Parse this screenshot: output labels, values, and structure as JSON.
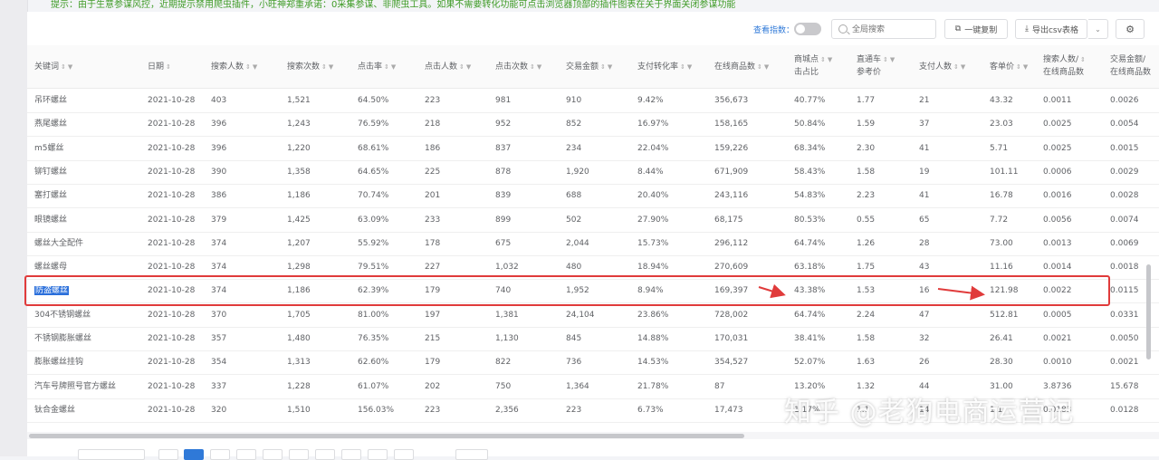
{
  "notice": "提示：由于生意参谋风控，近期提示禁用爬虫插件，小旺神郑重承诺：0采集参谋、非爬虫工具。如果不需要转化功能可点击浏览器顶部的插件图表在关于界面关闭参谋功能",
  "toolbar": {
    "index_toggle_label": "查看指数：",
    "search_placeholder": "全局搜索",
    "copy_label": "一键复制",
    "export_label": "导出csv表格"
  },
  "columns": [
    {
      "label": "关键词",
      "sort": true,
      "filter": true
    },
    {
      "label": "日期",
      "sort": true,
      "filter": false
    },
    {
      "label": "搜索人数",
      "sort": true,
      "filter": true
    },
    {
      "label": "搜索次数",
      "sort": true,
      "filter": true
    },
    {
      "label": "点击率",
      "sort": true,
      "filter": true
    },
    {
      "label": "点击人数",
      "sort": true,
      "filter": true
    },
    {
      "label": "点击次数",
      "sort": true,
      "filter": true
    },
    {
      "label": "交易金额",
      "sort": true,
      "filter": true
    },
    {
      "label": "支付转化率",
      "sort": true,
      "filter": true
    },
    {
      "label": "在线商品数",
      "sort": true,
      "filter": true
    },
    {
      "label": "商城点\n击占比",
      "sort": true,
      "filter": true
    },
    {
      "label": "直通车\n参考价",
      "sort": true,
      "filter": true
    },
    {
      "label": "支付人数",
      "sort": true,
      "filter": true
    },
    {
      "label": "客单价",
      "sort": true,
      "filter": true
    },
    {
      "label": "搜索人数/\n在线商品数",
      "sort": true,
      "filter": false
    },
    {
      "label": "交易金额/\n在线商品数",
      "sort": false,
      "filter": false
    }
  ],
  "rows": [
    [
      "吊环螺丝",
      "2021-10-28",
      "403",
      "1,521",
      "64.50%",
      "223",
      "981",
      "910",
      "9.42%",
      "356,673",
      "40.77%",
      "1.77",
      "21",
      "43.32",
      "0.0011",
      "0.0026"
    ],
    [
      "燕尾螺丝",
      "2021-10-28",
      "396",
      "1,243",
      "76.59%",
      "218",
      "952",
      "852",
      "16.97%",
      "158,165",
      "50.84%",
      "1.59",
      "37",
      "23.03",
      "0.0025",
      "0.0054"
    ],
    [
      "m5螺丝",
      "2021-10-28",
      "396",
      "1,220",
      "68.61%",
      "186",
      "837",
      "234",
      "22.04%",
      "159,226",
      "68.34%",
      "2.30",
      "41",
      "5.71",
      "0.0025",
      "0.0015"
    ],
    [
      "铆钉螺丝",
      "2021-10-28",
      "390",
      "1,358",
      "64.65%",
      "225",
      "878",
      "1,920",
      "8.44%",
      "671,909",
      "58.43%",
      "1.58",
      "19",
      "101.11",
      "0.0006",
      "0.0029"
    ],
    [
      "塞打螺丝",
      "2021-10-28",
      "386",
      "1,186",
      "70.74%",
      "201",
      "839",
      "688",
      "20.40%",
      "243,116",
      "54.83%",
      "2.23",
      "41",
      "16.78",
      "0.0016",
      "0.0028"
    ],
    [
      "眼镜螺丝",
      "2021-10-28",
      "379",
      "1,425",
      "63.09%",
      "233",
      "899",
      "502",
      "27.90%",
      "68,175",
      "80.53%",
      "0.55",
      "65",
      "7.72",
      "0.0056",
      "0.0074"
    ],
    [
      "螺丝大全配件",
      "2021-10-28",
      "374",
      "1,207",
      "55.92%",
      "178",
      "675",
      "2,044",
      "15.73%",
      "296,112",
      "64.74%",
      "1.26",
      "28",
      "73.00",
      "0.0013",
      "0.0069"
    ],
    [
      "螺丝螺母",
      "2021-10-28",
      "374",
      "1,298",
      "79.51%",
      "227",
      "1,032",
      "480",
      "18.94%",
      "270,609",
      "63.18%",
      "1.75",
      "43",
      "11.16",
      "0.0014",
      "0.0018"
    ],
    [
      "防盗螺丝",
      "2021-10-28",
      "374",
      "1,186",
      "62.39%",
      "179",
      "740",
      "1,952",
      "8.94%",
      "169,397",
      "43.38%",
      "1.53",
      "16",
      "121.98",
      "0.0022",
      "0.0115"
    ],
    [
      "304不锈钢螺丝",
      "2021-10-28",
      "370",
      "1,705",
      "81.00%",
      "197",
      "1,381",
      "24,104",
      "23.86%",
      "728,002",
      "64.74%",
      "2.24",
      "47",
      "512.81",
      "0.0005",
      "0.0331"
    ],
    [
      "不锈钢膨胀螺丝",
      "2021-10-28",
      "357",
      "1,480",
      "76.35%",
      "215",
      "1,130",
      "845",
      "14.88%",
      "170,031",
      "38.41%",
      "1.58",
      "32",
      "26.41",
      "0.0021",
      "0.0050"
    ],
    [
      "膨胀螺丝挂钩",
      "2021-10-28",
      "354",
      "1,313",
      "62.60%",
      "179",
      "822",
      "736",
      "14.53%",
      "354,527",
      "52.07%",
      "1.63",
      "26",
      "28.30",
      "0.0010",
      "0.0021"
    ],
    [
      "汽车号牌照号官方螺丝",
      "2021-10-28",
      "337",
      "1,228",
      "61.07%",
      "202",
      "750",
      "1,364",
      "21.78%",
      "87",
      "13.20%",
      "1.32",
      "44",
      "31.00",
      "3.8736",
      "15.678"
    ],
    [
      "钛合金螺丝",
      "2021-10-28",
      "320",
      "1,510",
      "156.03%",
      "223",
      "2,356",
      "223",
      "6.73%",
      "17,473",
      "1.17%",
      "1.1",
      "14",
      "1.1",
      "0.0183",
      "0.0128"
    ]
  ],
  "selected_row_index": 8,
  "watermark": "知乎 @老狗电商运营记",
  "colors": {
    "notice": "#3f9b27",
    "highlight": "#e03b3b",
    "selection": "#2a6fdb",
    "toolbar_label": "#2f79d8"
  }
}
